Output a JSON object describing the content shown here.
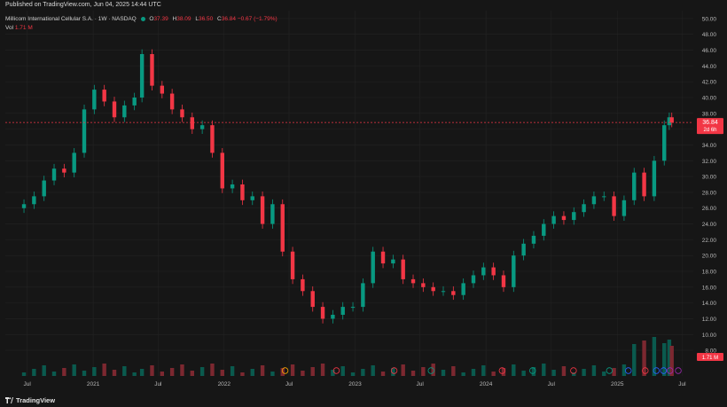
{
  "header": {
    "published": "Published on TradingView.com, Jun 04, 2025 14:44 UTC"
  },
  "legend": {
    "symbol": "Millicom International Cellular S.A. · 1W · NASDAQ",
    "o_label": "O",
    "o_value": "37.39",
    "h_label": "H",
    "h_value": "38.09",
    "l_label": "L",
    "l_value": "36.50",
    "c_label": "C",
    "c_value": "36.84",
    "change": "−0.67 (−1.79%)",
    "vol_label": "Vol",
    "vol_value": "1.71 M"
  },
  "price_badge": {
    "price": "36.84",
    "countdown": "2d 6h"
  },
  "volume_badge": "1.71 M",
  "footer": {
    "brand": "TradingView"
  },
  "colors": {
    "up": "#089981",
    "down": "#f23645",
    "bg": "#161616",
    "grid": "#232323",
    "vol_up": "#0a5a4e",
    "vol_down": "#7c2830"
  },
  "chart_data": {
    "type": "candlestick",
    "y_ticks": [
      "50.00",
      "48.00",
      "46.00",
      "44.00",
      "42.00",
      "40.00",
      "38.00",
      "36.00",
      "34.00",
      "32.00",
      "30.00",
      "28.00",
      "26.00",
      "24.00",
      "22.00",
      "20.00",
      "18.00",
      "16.00",
      "14.00",
      "12.00",
      "10.00",
      "8.00"
    ],
    "x_ticks": [
      "Jul",
      "2021",
      "Jul",
      "2022",
      "Jul",
      "2023",
      "Jul",
      "2024",
      "Jul",
      "2025",
      "Jul"
    ],
    "y_range": [
      7,
      51
    ],
    "last_price": 36.84,
    "series": [
      {
        "date": "2020-06-22",
        "close": 26.5
      },
      {
        "date": "2020-07-20",
        "close": 27.5
      },
      {
        "date": "2020-08-17",
        "close": 29.5
      },
      {
        "date": "2020-09-14",
        "close": 31.0
      },
      {
        "date": "2020-10-12",
        "close": 30.5
      },
      {
        "date": "2020-11-09",
        "close": 33.0
      },
      {
        "date": "2020-12-07",
        "close": 38.5
      },
      {
        "date": "2021-01-04",
        "close": 41.0
      },
      {
        "date": "2021-02-01",
        "close": 39.5
      },
      {
        "date": "2021-03-01",
        "close": 37.5
      },
      {
        "date": "2021-03-29",
        "close": 39.0
      },
      {
        "date": "2021-04-26",
        "close": 40.0
      },
      {
        "date": "2021-05-17",
        "close": 45.5
      },
      {
        "date": "2021-06-14",
        "close": 41.5
      },
      {
        "date": "2021-07-12",
        "close": 40.5
      },
      {
        "date": "2021-08-09",
        "close": 38.5
      },
      {
        "date": "2021-09-06",
        "close": 37.5
      },
      {
        "date": "2021-10-04",
        "close": 36.0
      },
      {
        "date": "2021-11-01",
        "close": 36.5
      },
      {
        "date": "2021-11-29",
        "close": 33.0
      },
      {
        "date": "2021-12-27",
        "close": 28.5
      },
      {
        "date": "2022-01-24",
        "close": 29.0
      },
      {
        "date": "2022-02-21",
        "close": 27.0
      },
      {
        "date": "2022-03-21",
        "close": 27.5
      },
      {
        "date": "2022-04-18",
        "close": 24.0
      },
      {
        "date": "2022-05-16",
        "close": 26.5
      },
      {
        "date": "2022-06-13",
        "close": 20.5
      },
      {
        "date": "2022-07-11",
        "close": 17.0
      },
      {
        "date": "2022-08-08",
        "close": 15.5
      },
      {
        "date": "2022-09-05",
        "close": 13.5
      },
      {
        "date": "2022-10-03",
        "close": 12.0
      },
      {
        "date": "2022-10-31",
        "close": 12.5
      },
      {
        "date": "2022-11-28",
        "close": 13.5
      },
      {
        "date": "2022-12-26",
        "close": 13.5
      },
      {
        "date": "2023-01-23",
        "close": 16.5
      },
      {
        "date": "2023-02-20",
        "close": 20.5
      },
      {
        "date": "2023-03-20",
        "close": 19.0
      },
      {
        "date": "2023-04-17",
        "close": 19.5
      },
      {
        "date": "2023-05-15",
        "close": 17.0
      },
      {
        "date": "2023-06-12",
        "close": 16.5
      },
      {
        "date": "2023-07-10",
        "close": 16.0
      },
      {
        "date": "2023-08-07",
        "close": 15.5
      },
      {
        "date": "2023-09-04",
        "close": 15.5
      },
      {
        "date": "2023-10-02",
        "close": 15.0
      },
      {
        "date": "2023-10-30",
        "close": 16.5
      },
      {
        "date": "2023-11-27",
        "close": 17.5
      },
      {
        "date": "2023-12-25",
        "close": 18.5
      },
      {
        "date": "2024-01-22",
        "close": 17.5
      },
      {
        "date": "2024-02-19",
        "close": 16.0
      },
      {
        "date": "2024-03-18",
        "close": 20.0
      },
      {
        "date": "2024-04-15",
        "close": 21.5
      },
      {
        "date": "2024-05-13",
        "close": 22.5
      },
      {
        "date": "2024-06-10",
        "close": 24.0
      },
      {
        "date": "2024-07-08",
        "close": 25.0
      },
      {
        "date": "2024-08-05",
        "close": 24.5
      },
      {
        "date": "2024-09-02",
        "close": 25.5
      },
      {
        "date": "2024-09-30",
        "close": 26.5
      },
      {
        "date": "2024-10-28",
        "close": 27.5
      },
      {
        "date": "2024-11-25",
        "close": 27.5
      },
      {
        "date": "2024-12-23",
        "close": 25.0
      },
      {
        "date": "2025-01-20",
        "close": 27.0
      },
      {
        "date": "2025-02-17",
        "close": 30.5
      },
      {
        "date": "2025-03-17",
        "close": 27.5
      },
      {
        "date": "2025-04-14",
        "close": 32.0
      },
      {
        "date": "2025-05-12",
        "close": 36.5
      },
      {
        "date": "2025-05-26",
        "close": 37.5
      },
      {
        "date": "2025-06-02",
        "close": 36.84
      }
    ]
  }
}
